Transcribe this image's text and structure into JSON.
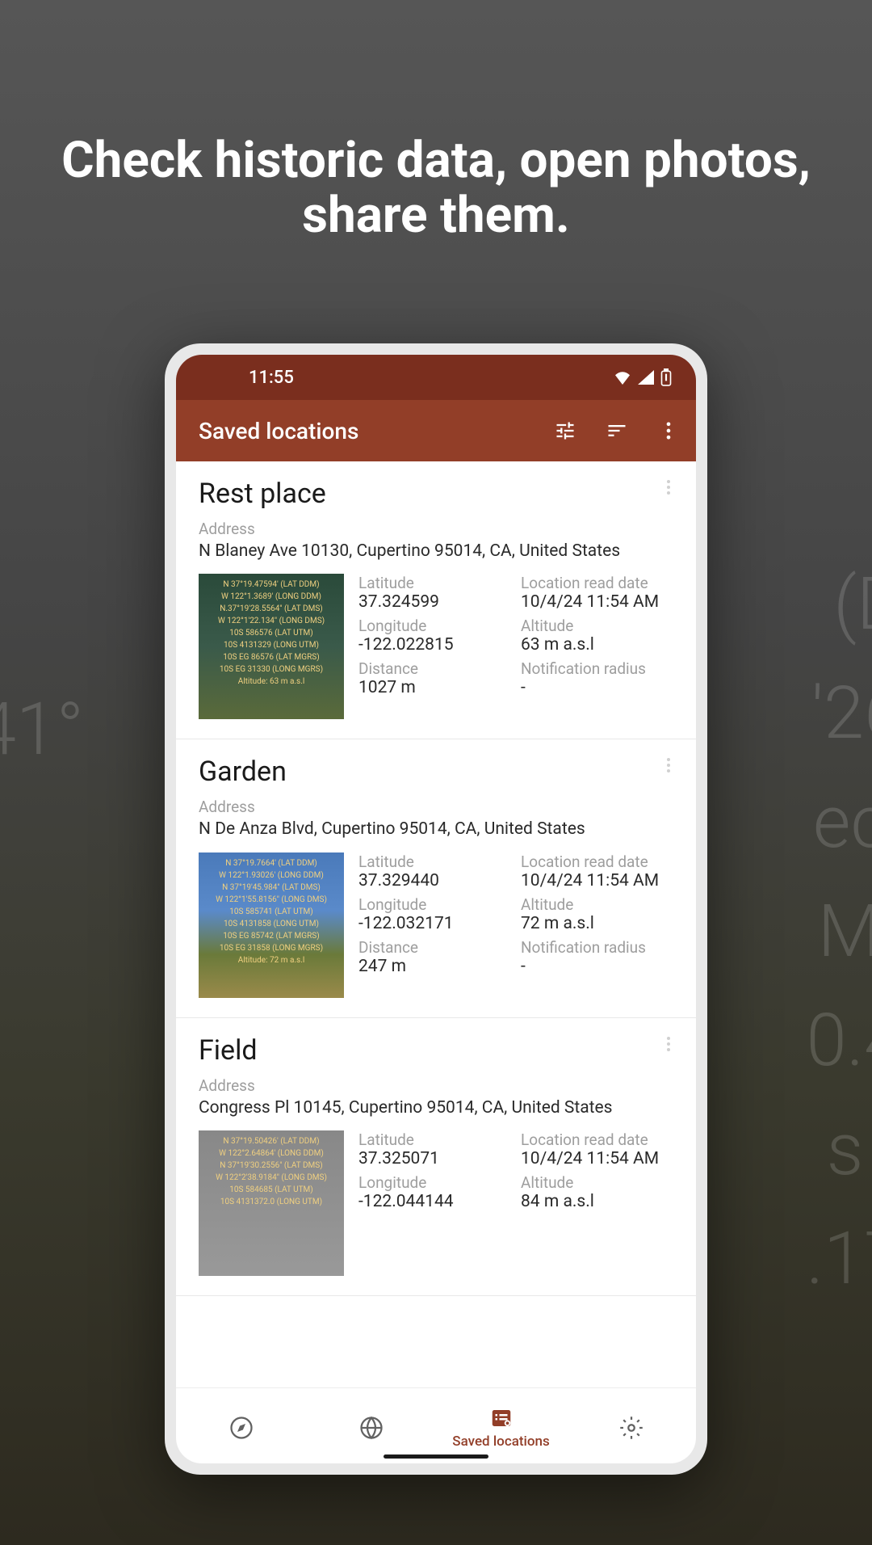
{
  "promo": "Check historic data, open photos, share them.",
  "statusBar": {
    "time": "11:55"
  },
  "appBar": {
    "title": "Saved locations"
  },
  "labels": {
    "address": "Address",
    "latitude": "Latitude",
    "longitude": "Longitude",
    "distance": "Distance",
    "readDate": "Location read date",
    "altitude": "Altitude",
    "radius": "Notification radius"
  },
  "locations": [
    {
      "title": "Rest place",
      "address": "N Blaney Ave 10130, Cupertino 95014, CA, United States",
      "latitude": "37.324599",
      "longitude": "-122.022815",
      "distance": "1027 m",
      "readDate": "10/4/24 11:54 AM",
      "altitude": "63 m a.s.l",
      "radius": "-",
      "thumbLines": [
        "N 37°19.47594' (LAT DDM)",
        "W 122°1.3689' (LONG DDM)",
        "N.37°19'28.5564\" (LAT DMS)",
        "W 122°1'22.134\" (LONG DMS)",
        "10S 586576 (LAT UTM)",
        "10S 4131329 (LONG UTM)",
        "10S EG 86576 (LAT MGRS)",
        "10S EG 31330 (LONG MGRS)",
        "Altitude: 63 m a.s.l"
      ]
    },
    {
      "title": "Garden",
      "address": "N De Anza Blvd, Cupertino 95014, CA, United States",
      "latitude": "37.329440",
      "longitude": "-122.032171",
      "distance": "247 m",
      "readDate": "10/4/24 11:54 AM",
      "altitude": "72 m a.s.l",
      "radius": "-",
      "thumbLines": [
        "N 37°19.7664' (LAT DDM)",
        "W 122°1.93026' (LONG DDM)",
        "N 37°19'45.984\" (LAT DMS)",
        "W 122°1'55.8156\" (LONG DMS)",
        "10S 585741 (LAT UTM)",
        "10S 4131858 (LONG UTM)",
        "10S EG 85742 (LAT MGRS)",
        "10S EG 31858 (LONG MGRS)",
        "Altitude: 72 m a.s.l"
      ]
    },
    {
      "title": "Field",
      "address": "Congress Pl 10145, Cupertino 95014, CA, United States",
      "latitude": "37.325071",
      "longitude": "-122.044144",
      "distance": "",
      "readDate": "10/4/24 11:54 AM",
      "altitude": "84 m a.s.l",
      "radius": "",
      "thumbLines": [
        "N 37°19.50426' (LAT DDM)",
        "W 122°2.64864' (LONG DDM)",
        "N 37°19'30.2556\" (LAT DMS)",
        "W 122°2'38.9184\" (LONG DMS)",
        "10S 584685 (LAT UTM)",
        "10S 4131372.0 (LONG UTM)"
      ]
    }
  ],
  "bottomNav": {
    "savedLabel": "Saved locations"
  }
}
